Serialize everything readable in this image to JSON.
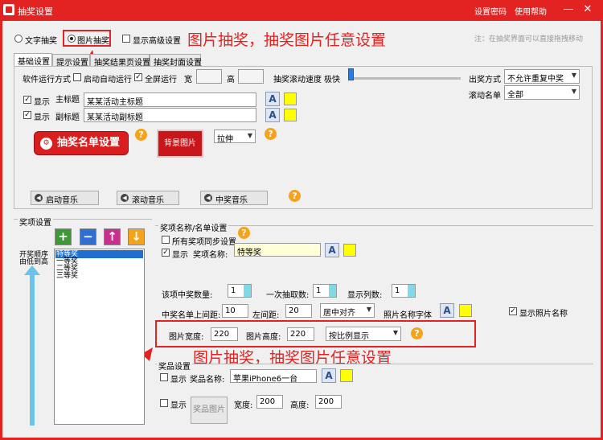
{
  "window": {
    "title": "抽奖设置",
    "links": [
      "设置密码",
      "使用帮助"
    ],
    "minimize": "—",
    "close": "✕"
  },
  "mode": {
    "options": [
      "文字抽奖",
      "图片抽奖"
    ],
    "selected": "图片抽奖",
    "advanced_label": "显示高级设置",
    "annotation": "图片抽奖，抽奖图片任意设置",
    "hint": "注：在抽奖界面可以直接拖拽移动"
  },
  "tabs": [
    "基础设置",
    "提示设置",
    "抽奖结果页设置",
    "抽奖封面设置"
  ],
  "basic": {
    "run_mode_label": "软件运行方式",
    "auto_run": "启动自动运行",
    "fullscreen": "全屏运行",
    "width_label": "宽",
    "height_label": "高",
    "speed_label": "抽奖滚动速度",
    "speed_fast": "极快",
    "show_label": "显示",
    "main_title_label": "主标题",
    "main_title_value": "某某活动主标题",
    "sub_title_label": "副标题",
    "sub_title_value": "某某活动副标题",
    "list_button": "抽奖名单设置",
    "bg_button": "背景图片",
    "stretch_value": "拉伸",
    "draw_mode_label": "出奖方式",
    "draw_mode_value": "不允许重复中奖",
    "scroll_list_label": "滚动名单",
    "scroll_list_value": "全部",
    "music_buttons": [
      "启动音乐",
      "滚动音乐",
      "中奖音乐"
    ],
    "font_glyph": "A",
    "help_glyph": "?"
  },
  "prizes": {
    "section_title": "奖项设置",
    "order_label_line1": "开奖顺序",
    "order_label_line2": "由低到高",
    "add": "+",
    "remove": "−",
    "up": "↑",
    "down": "↓",
    "items": [
      "特等奖",
      "一等奖",
      "二等奖",
      "三等奖"
    ],
    "selected_index": 0
  },
  "prize_name": {
    "section_title": "奖项名称/名单设置",
    "sync_label": "所有奖项同步设置",
    "show_label": "显示",
    "name_label": "奖项名称:",
    "name_value": "特等奖",
    "winner_count_label": "该项中奖数量:",
    "winner_count_value": "1",
    "per_draw_label": "一次抽取数:",
    "per_draw_value": "1",
    "columns_label": "显示列数:",
    "columns_value": "1",
    "top_margin_label": "中奖名单上间距:",
    "top_margin_value": "10",
    "left_margin_label": "左间距:",
    "left_margin_value": "20",
    "align_value": "居中对齐",
    "photo_font_label": "照片名称字体",
    "show_photo_name": "显示照片名称",
    "img_width_label": "图片宽度:",
    "img_width_value": "220",
    "img_height_label": "图片高度:",
    "img_height_value": "220",
    "scale_value": "按比例显示",
    "annotation": "图片抽奖，抽奖图片任意设置"
  },
  "award": {
    "section_title": "奖品设置",
    "show_label": "显示",
    "name_label": "奖品名称:",
    "name_value": "苹果iPhone6一台",
    "image_button": "奖品图片",
    "width_label": "宽度:",
    "width_value": "200",
    "height_label": "高度:",
    "height_value": "200"
  },
  "colors": {
    "brand_red": "#e32322",
    "highlight_yellow": "#ffff00",
    "spin_cyan": "#7fd9e6",
    "help_orange": "#f7a21b"
  }
}
